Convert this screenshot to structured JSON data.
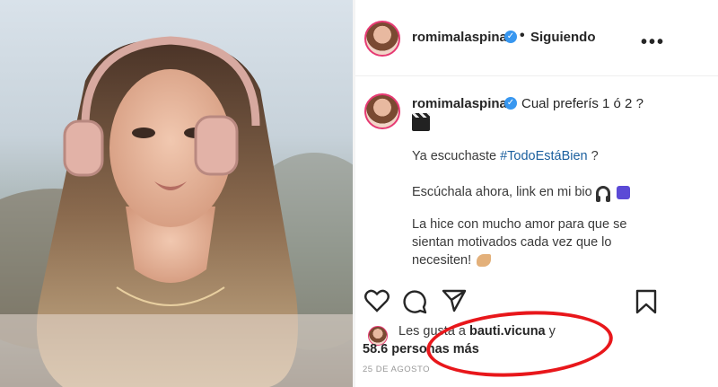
{
  "post": {
    "username": "romimalaspina",
    "follow_status": "Siguiendo",
    "caption": {
      "line1": "Cual preferís 1 ó 2 ?",
      "line2_prefix": "Ya escuchaste",
      "hashtag": "#TodoEstáBien",
      "line2_suffix": "?",
      "line3": "Escúchala ahora, link en mi bio",
      "line4": "La hice con mucho amor para que se",
      "line5": "sientan motivados cada vez que lo",
      "line6": "necesiten!"
    },
    "likes": {
      "prefix": "Les gusta a",
      "liker": "bauti.vicuna",
      "joiner": "y",
      "count": "58.6",
      "suffix": "personas más"
    },
    "date": "25 DE AGOSTO"
  },
  "icons": [
    "verified-icon",
    "more-options-icon",
    "heart-icon",
    "comment-icon",
    "share-icon",
    "bookmark-icon",
    "headphones-icon",
    "music-note-icon",
    "flexed-arm-icon",
    "clapper-icon"
  ],
  "colors": {
    "verified": "#3897f0",
    "hashtag": "#1a5f9e",
    "annotation_circle": "#e8171b"
  }
}
